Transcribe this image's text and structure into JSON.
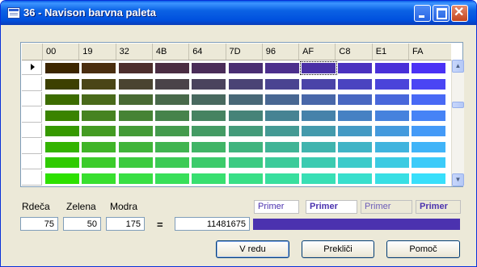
{
  "window": {
    "title": "36 - Navison barvna paleta"
  },
  "grid": {
    "columns": [
      "00",
      "19",
      "32",
      "4B",
      "64",
      "7D",
      "96",
      "AF",
      "C8",
      "E1",
      "FA"
    ],
    "rows": [
      [
        "#3c2600",
        "#4a2e10",
        "#4d2e2d",
        "#4b2d43",
        "#4a2c59",
        "#4a2e73",
        "#4c2f8d",
        "#4a30a6",
        "#4a31bf",
        "#4930d8",
        "#4a31f5"
      ],
      [
        "#3c4000",
        "#4a4516",
        "#4a4431",
        "#4a4349",
        "#4a435d",
        "#4a4375",
        "#4a4491",
        "#4a44a8",
        "#4a44c0",
        "#4a44da",
        "#4a45f4"
      ],
      [
        "#3c6c00",
        "#496a1a",
        "#486a33",
        "#48694a",
        "#48695f",
        "#486877",
        "#486792",
        "#4867a9",
        "#4867c1",
        "#4867db",
        "#4869f5"
      ],
      [
        "#3a8300",
        "#468320",
        "#468335",
        "#46834b",
        "#468361",
        "#468378",
        "#468393",
        "#4682aa",
        "#4681c3",
        "#4682dd",
        "#4683f6"
      ],
      [
        "#369900",
        "#449b23",
        "#449b37",
        "#449b4d",
        "#449b64",
        "#449b7a",
        "#449a94",
        "#449aac",
        "#449ac4",
        "#449add",
        "#449af7"
      ],
      [
        "#33b300",
        "#40b428",
        "#40b43a",
        "#40b450",
        "#40b466",
        "#40b47e",
        "#40b496",
        "#40b4ae",
        "#40b4c6",
        "#40b4de",
        "#40b4f8"
      ],
      [
        "#2fcb00",
        "#3ccc2b",
        "#3ccb3f",
        "#3ccb55",
        "#3ccb6b",
        "#3ccb82",
        "#3ccb9a",
        "#3ccbb1",
        "#3ccbca",
        "#3ccbe2",
        "#3ccbf9"
      ],
      [
        "#2de000",
        "#38df2f",
        "#38df44",
        "#38df59",
        "#38df70",
        "#38df86",
        "#38df9e",
        "#38dfb5",
        "#38dfcd",
        "#38dfe4",
        "#38dffb"
      ]
    ],
    "selected_row": 0,
    "focused_cell": [
      0,
      7
    ]
  },
  "labels": {
    "red": "Rdeča",
    "green": "Zelena",
    "blue": "Modra"
  },
  "values": {
    "red": "75",
    "green": "50",
    "blue": "175",
    "equals": "=",
    "combined": "11481675"
  },
  "preview": {
    "samples": [
      "Primer",
      "Primer",
      "Primer",
      "Primer"
    ],
    "color": "#4b32af"
  },
  "buttons": {
    "ok": "V redu",
    "cancel": "Prekliči",
    "help": "Pomoč"
  }
}
